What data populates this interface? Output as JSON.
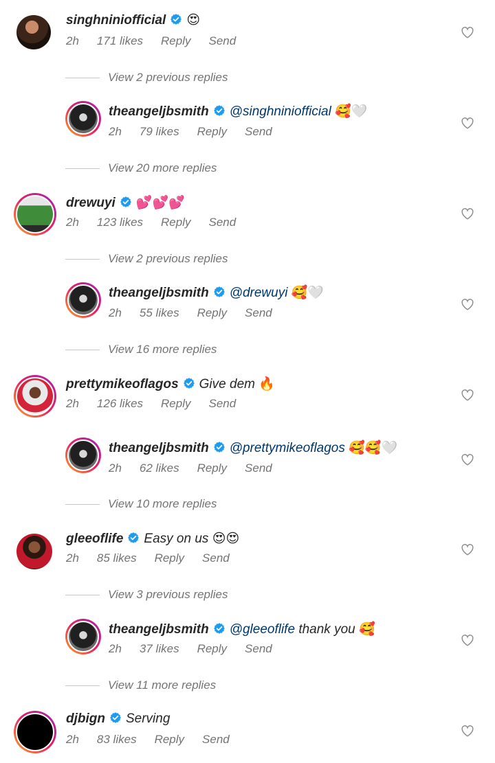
{
  "colors": {
    "text": "#262626",
    "meta": "#737373",
    "mention": "#00376b",
    "badge": "#1d9bf0"
  },
  "icons": {
    "verified": "verified-badge-icon",
    "like": "heart-outline-icon"
  },
  "threads": [
    {
      "comment": {
        "user": "singhniniofficial",
        "text": "",
        "emoji": "😍",
        "time": "2h",
        "likes": "171 likes",
        "reply": "Reply",
        "send": "Send"
      },
      "previous": "View 2 previous replies",
      "reply": {
        "user": "theangeljbsmith",
        "mention": "@singhniniofficial",
        "text": "",
        "emoji": "🥰🤍",
        "time": "2h",
        "likes": "79 likes",
        "reply": "Reply",
        "send": "Send"
      },
      "more": "View 20 more replies"
    },
    {
      "comment": {
        "user": "drewuyi",
        "text": "",
        "emoji": "💕💕💕",
        "time": "2h",
        "likes": "123 likes",
        "reply": "Reply",
        "send": "Send"
      },
      "previous": "View 2 previous replies",
      "reply": {
        "user": "theangeljbsmith",
        "mention": "@drewuyi",
        "text": "",
        "emoji": "🥰🤍",
        "time": "2h",
        "likes": "55 likes",
        "reply": "Reply",
        "send": "Send"
      },
      "more": "View 16 more replies"
    },
    {
      "comment": {
        "user": "prettymikeoflagos",
        "text": "Give dem",
        "emoji": "🔥",
        "time": "2h",
        "likes": "126 likes",
        "reply": "Reply",
        "send": "Send"
      },
      "reply": {
        "user": "theangeljbsmith",
        "mention": "@prettymikeoflagos",
        "text": "",
        "emoji": "🥰🥰🤍",
        "time": "2h",
        "likes": "62 likes",
        "reply": "Reply",
        "send": "Send"
      },
      "more": "View 10 more replies"
    },
    {
      "comment": {
        "user": "gleeoflife",
        "text": "Easy on us",
        "emoji": "😍😍",
        "time": "2h",
        "likes": "85 likes",
        "reply": "Reply",
        "send": "Send"
      },
      "previous": "View 3 previous replies",
      "reply": {
        "user": "theangeljbsmith",
        "mention": "@gleeoflife",
        "text": "thank you",
        "emoji": "🥰",
        "time": "2h",
        "likes": "37 likes",
        "reply": "Reply",
        "send": "Send"
      },
      "more": "View 11 more replies"
    },
    {
      "comment": {
        "user": "djbign",
        "text": "Serving",
        "emoji": "",
        "time": "2h",
        "likes": "83 likes",
        "reply": "Reply",
        "send": "Send"
      }
    }
  ]
}
